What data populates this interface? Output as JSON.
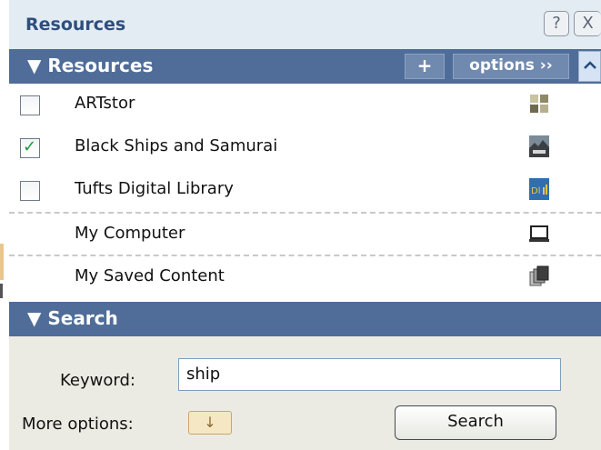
{
  "window": {
    "title": "Resources",
    "help_label": "?",
    "close_label": "X"
  },
  "resources_section": {
    "header": "▼ Resources",
    "add_label": "+",
    "options_label": "options ››",
    "scroll_up_label": "^",
    "items": [
      {
        "label": "ARTstor",
        "checked": false,
        "icon": "artstor-icon"
      },
      {
        "label": "Black Ships and Samurai",
        "checked": true,
        "icon": "ships-thumbnail-icon"
      },
      {
        "label": "Tufts Digital Library",
        "checked": false,
        "icon": "tufts-dl-icon"
      },
      {
        "label": "My Computer",
        "icon": "computer-icon"
      },
      {
        "label": "My Saved Content",
        "icon": "saved-content-icon"
      }
    ],
    "check_mark": "✓"
  },
  "search_section": {
    "header": "▼ Search",
    "keyword_label": "Keyword:",
    "keyword_value": "ship",
    "more_options_label": "More options:",
    "more_options_icon": "↓",
    "search_button": "Search"
  }
}
